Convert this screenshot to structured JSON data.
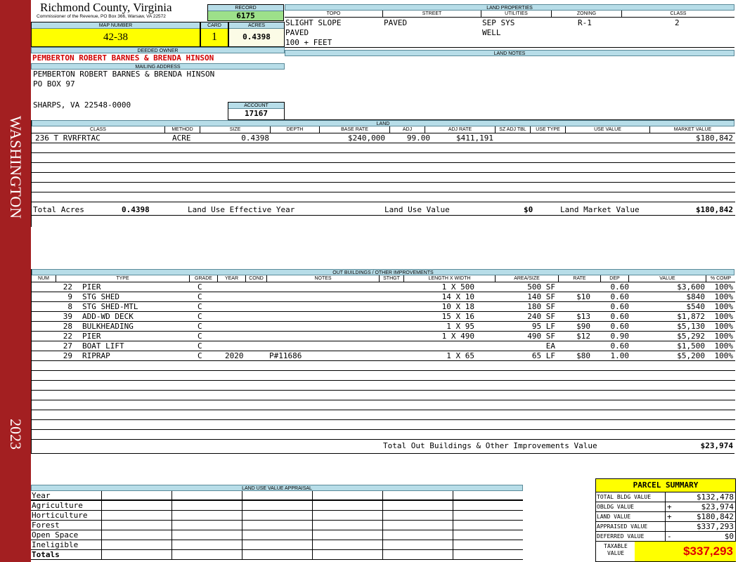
{
  "band": {
    "label_top": "WASHINGTON",
    "label_bottom": "2023",
    "color": "#a31f21"
  },
  "header": {
    "county": "Richmond County, Virginia",
    "commissioner": "Commissioner of the Revenue, PO Box 366, Warsaw, VA 22572",
    "record_label": "RECORD",
    "record": "6175",
    "map_label": "MAP NUMBER",
    "map": "42-38",
    "card_label": "CARD",
    "card": "1",
    "acres_label": "ACRES",
    "acres": "0.4398"
  },
  "owner": {
    "deeded_label": "DEEDED OWNER",
    "deeded": "PEMBERTON ROBERT BARNES & BRENDA HINSON",
    "mailing_label": "MAILING ADDRESS",
    "line1": "PEMBERTON ROBERT BARNES & BRENDA HINSON",
    "line2": "PO BOX 97",
    "line3": "SHARPS, VA 22548-0000",
    "account_label": "ACCOUNT",
    "account": "17167"
  },
  "land_properties": {
    "title": "LAND PROPERTIES",
    "cols": [
      "TOPO",
      "STREET",
      "UTILITIES",
      "ZONING",
      "CLASS"
    ],
    "topo": [
      "SLIGHT SLOPE",
      "PAVED",
      "100 + FEET"
    ],
    "street": "PAVED",
    "utilities": [
      "SEP SYS",
      "WELL"
    ],
    "zoning": "R-1",
    "class": "2"
  },
  "land_notes": {
    "title": "LAND NOTES"
  },
  "land": {
    "title": "LAND",
    "cols": [
      "CLASS",
      "METHOD",
      "SIZE",
      "DEPTH",
      "BASE RATE",
      "ADJ",
      "ADJ RATE",
      "SZ ADJ TBL",
      "USE TYPE",
      "USE VALUE",
      "MARKET VALUE"
    ],
    "row": {
      "class": "236 T RVRFRTAC",
      "method": "ACRE",
      "size": "0.4398",
      "base_rate": "$240,000",
      "adj": "99.00",
      "adj_rate": "$411,191",
      "market_value": "$180,842"
    },
    "total_acres_label": "Total Acres",
    "total_acres": "0.4398",
    "effective_label": "Land Use Effective Year",
    "use_value_label": "Land Use Value",
    "use_value": "$0",
    "market_label": "Land Market Value",
    "market_value": "$180,842"
  },
  "outbuildings": {
    "title": "OUT BUILDINGS / OTHER IMPROVEMENTS",
    "cols": [
      "NUM",
      "TYPE",
      "GRADE",
      "YEAR",
      "COND",
      "NOTES",
      "STHGT",
      "LENGTH X WIDTH",
      "AREA/SIZE",
      "RATE",
      "DEP",
      "VALUE",
      "% COMP"
    ],
    "rows": [
      {
        "num": "22",
        "type": "PIER",
        "grade": "C",
        "year": "",
        "notes": "",
        "lw": "1 X 500",
        "area": "500 SF",
        "rate": "",
        "dep": "0.60",
        "value": "$3,600",
        "comp": "100%"
      },
      {
        "num": "9",
        "type": "STG SHED",
        "grade": "C",
        "year": "",
        "notes": "",
        "lw": "14 X 10",
        "area": "140 SF",
        "rate": "$10",
        "dep": "0.60",
        "value": "$840",
        "comp": "100%"
      },
      {
        "num": "8",
        "type": "STG SHED-MTL",
        "grade": "C",
        "year": "",
        "notes": "",
        "lw": "10 X 18",
        "area": "180 SF",
        "rate": "",
        "dep": "0.60",
        "value": "$540",
        "comp": "100%"
      },
      {
        "num": "39",
        "type": "ADD-WD DECK",
        "grade": "C",
        "year": "",
        "notes": "",
        "lw": "15 X 16",
        "area": "240 SF",
        "rate": "$13",
        "dep": "0.60",
        "value": "$1,872",
        "comp": "100%"
      },
      {
        "num": "28",
        "type": "BULKHEADING",
        "grade": "C",
        "year": "",
        "notes": "",
        "lw": "1 X 95",
        "area": "95 LF",
        "rate": "$90",
        "dep": "0.60",
        "value": "$5,130",
        "comp": "100%"
      },
      {
        "num": "22",
        "type": "PIER",
        "grade": "C",
        "year": "",
        "notes": "",
        "lw": "1 X 490",
        "area": "490 SF",
        "rate": "$12",
        "dep": "0.90",
        "value": "$5,292",
        "comp": "100%"
      },
      {
        "num": "27",
        "type": "BOAT LIFT",
        "grade": "C",
        "year": "",
        "notes": "",
        "lw": "",
        "area": "EA",
        "rate": "",
        "dep": "0.60",
        "value": "$1,500",
        "comp": "100%"
      },
      {
        "num": "29",
        "type": "RIPRAP",
        "grade": "C",
        "year": "2020",
        "notes": "P#11686",
        "lw": "1 X 65",
        "area": "65 LF",
        "rate": "$80",
        "dep": "1.00",
        "value": "$5,200",
        "comp": "100%"
      }
    ],
    "total_label": "Total Out Buildings & Other Improvements Value",
    "total": "$23,974"
  },
  "land_use_appraisal": {
    "title": "LAND USE VALUE APPRAISAL",
    "rows": [
      "Year",
      "Agriculture",
      "Horticulture",
      "Forest",
      "Open Space",
      "Ineligible",
      "Totals"
    ]
  },
  "summary": {
    "title": "PARCEL SUMMARY",
    "rows": [
      {
        "label": "TOTAL BLDG VALUE",
        "sign": "",
        "value": "$132,478"
      },
      {
        "label": "OBLDG VALUE",
        "sign": "+",
        "value": "$23,974"
      },
      {
        "label": "LAND VALUE",
        "sign": "+",
        "value": "$180,842"
      },
      {
        "label": "APPRAISED VALUE",
        "sign": "",
        "value": "$337,293"
      },
      {
        "label": "DEFERRED VALUE",
        "sign": "-",
        "value": "$0"
      }
    ],
    "taxable_label": "TAXABLE VALUE",
    "taxable": "$337,293"
  }
}
